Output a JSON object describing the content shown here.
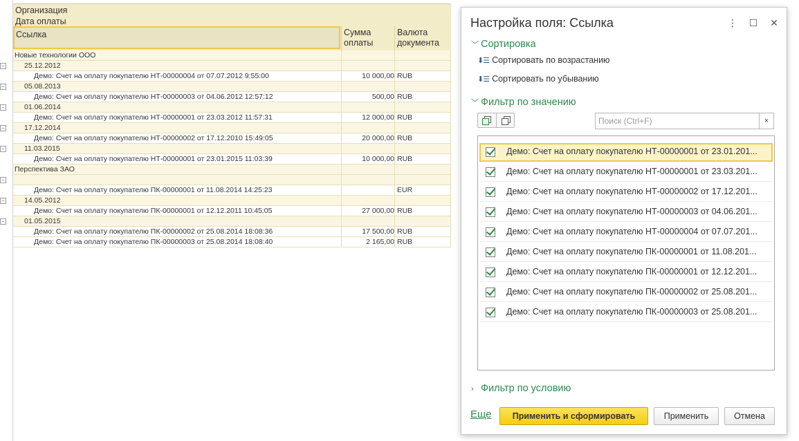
{
  "report": {
    "header": {
      "org": "Организация",
      "date": "Дата оплаты",
      "link": "Ссылка",
      "sum_l1": "Сумма",
      "sum_l2": "оплаты",
      "cur_l1": "Валюта",
      "cur_l2": "документа"
    },
    "rows": [
      {
        "type": "org",
        "text": "Новые технологии ООО"
      },
      {
        "type": "date",
        "text": "25.12.2012"
      },
      {
        "type": "doc",
        "text": "Демо: Счет на оплату покупателю НТ-00000004 от 07.07.2012 9:55:00",
        "amount": "10 000,00",
        "cur": "RUB"
      },
      {
        "type": "date",
        "text": "05.08.2013"
      },
      {
        "type": "doc",
        "text": "Демо: Счет на оплату покупателю НТ-00000003 от 04.06.2012 12:57:12",
        "amount": "500,00",
        "cur": "RUB"
      },
      {
        "type": "date",
        "text": "01.06.2014"
      },
      {
        "type": "doc",
        "text": "Демо: Счет на оплату покупателю НТ-00000001 от 23.03.2012 11:57:31",
        "amount": "12 000,00",
        "cur": "RUB"
      },
      {
        "type": "date",
        "text": "17.12.2014"
      },
      {
        "type": "doc",
        "text": "Демо: Счет на оплату покупателю НТ-00000002 от 17.12.2010 15:49:05",
        "amount": "20 000,00",
        "cur": "RUB"
      },
      {
        "type": "date",
        "text": "11.03.2015"
      },
      {
        "type": "doc",
        "text": "Демо: Счет на оплату покупателю НТ-00000001 от 23.01.2015 11:03:39",
        "amount": "10 000,00",
        "cur": "RUB"
      },
      {
        "type": "org",
        "text": "Перспектива ЗАО"
      },
      {
        "type": "date",
        "text": ""
      },
      {
        "type": "doc",
        "text": "Демо: Счет на оплату покупателю ПК-00000001 от 11.08.2014 14:25:23",
        "amount": "",
        "cur": "EUR"
      },
      {
        "type": "date",
        "text": "14.05.2012"
      },
      {
        "type": "doc",
        "text": "Демо: Счет на оплату покупателю ПК-00000001 от 12.12.2011 10:45:05",
        "amount": "27 000,00",
        "cur": "RUB"
      },
      {
        "type": "date",
        "text": "01.05.2015"
      },
      {
        "type": "doc",
        "text": "Демо: Счет на оплату покупателю ПК-00000002 от 25.08.2014 18:08:36",
        "amount": "17 500,00",
        "cur": "RUB"
      },
      {
        "type": "doc",
        "text": "Демо: Счет на оплату покупателю ПК-00000003 от 25.08.2014 18:08:40",
        "amount": "2 165,00",
        "cur": "RUB"
      }
    ]
  },
  "dialog": {
    "title": "Настройка поля: Ссылка",
    "more_icon": "⋮",
    "maximize_icon": "☐",
    "close_icon": "✕",
    "sort_section": "Сортировка",
    "sort_asc": "Сортировать по возрастанию",
    "sort_desc": "Сортировать по убыванию",
    "filter_value_section": "Фильтр по значению",
    "search_placeholder": "Поиск (Ctrl+F)",
    "search_value": "",
    "clear_icon": "×",
    "items": [
      {
        "label": "Демо: Счет на оплату покупателю НТ-00000001 от 23.01.201...",
        "checked": true,
        "selected": true
      },
      {
        "label": "Демо: Счет на оплату покупателю НТ-00000001 от 23.03.201...",
        "checked": true
      },
      {
        "label": "Демо: Счет на оплату покупателю НТ-00000002 от 17.12.201...",
        "checked": true
      },
      {
        "label": "Демо: Счет на оплату покупателю НТ-00000003 от 04.06.201...",
        "checked": true
      },
      {
        "label": "Демо: Счет на оплату покупателю НТ-00000004 от 07.07.201...",
        "checked": true
      },
      {
        "label": "Демо: Счет на оплату покупателю ПК-00000001 от 11.08.201...",
        "checked": true
      },
      {
        "label": "Демо: Счет на оплату покупателю ПК-00000001 от 12.12.201...",
        "checked": true
      },
      {
        "label": "Демо: Счет на оплату покупателю ПК-00000002 от 25.08.201...",
        "checked": true
      },
      {
        "label": "Демо: Счет на оплату покупателю ПК-00000003 от 25.08.201...",
        "checked": true
      }
    ],
    "filter_condition_section": "Фильтр по условию",
    "more_link": "Еще",
    "apply_and_build": "Применить и сформировать",
    "apply": "Применить",
    "cancel": "Отмена"
  },
  "colors": {
    "accent_green": "#2d8a4e",
    "header_bg": "#f3ecc8",
    "selection_border": "#f0c84a",
    "primary_button": "#f5cd10"
  }
}
